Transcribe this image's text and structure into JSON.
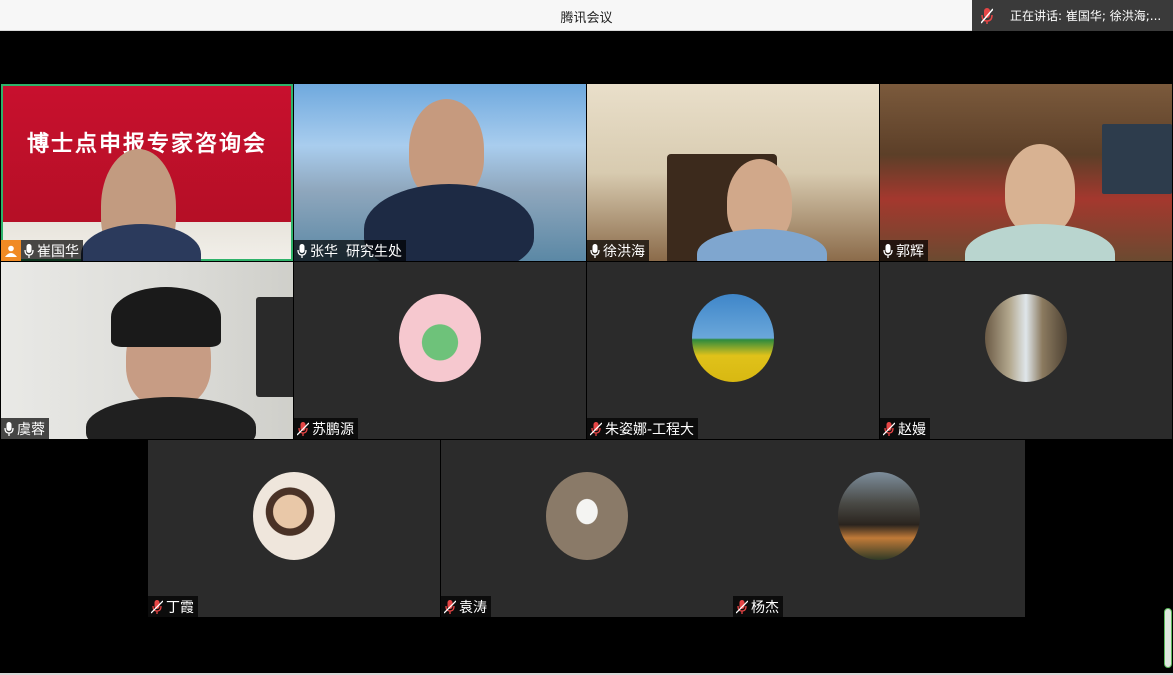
{
  "window": {
    "title": "腾讯会议"
  },
  "speaking": {
    "text": "正在讲话: 崔国华; 徐洪海;..."
  },
  "participants": [
    {
      "name": "崔国华",
      "role": "",
      "banner": "博士点申报专家咨询会"
    },
    {
      "name": "张华",
      "role": "研究生处"
    },
    {
      "name": "徐洪海",
      "role": ""
    },
    {
      "name": "郭辉",
      "role": ""
    },
    {
      "name": "虞蓉",
      "role": ""
    },
    {
      "name": "苏鹏源",
      "role": ""
    },
    {
      "name": "朱姿娜-工程大",
      "role": ""
    },
    {
      "name": "赵嫚",
      "role": ""
    },
    {
      "name": "丁霞",
      "role": ""
    },
    {
      "name": "袁涛",
      "role": ""
    },
    {
      "name": "杨杰",
      "role": ""
    }
  ],
  "colors": {
    "active_border": "#2fb36a",
    "host_badge": "#f08a24",
    "tile_bg": "#2b2b2b",
    "muted_icon": "#e64545"
  },
  "icons": {
    "mic": "microphone-icon",
    "mic_muted": "microphone-muted-icon",
    "host": "host-user-icon"
  }
}
